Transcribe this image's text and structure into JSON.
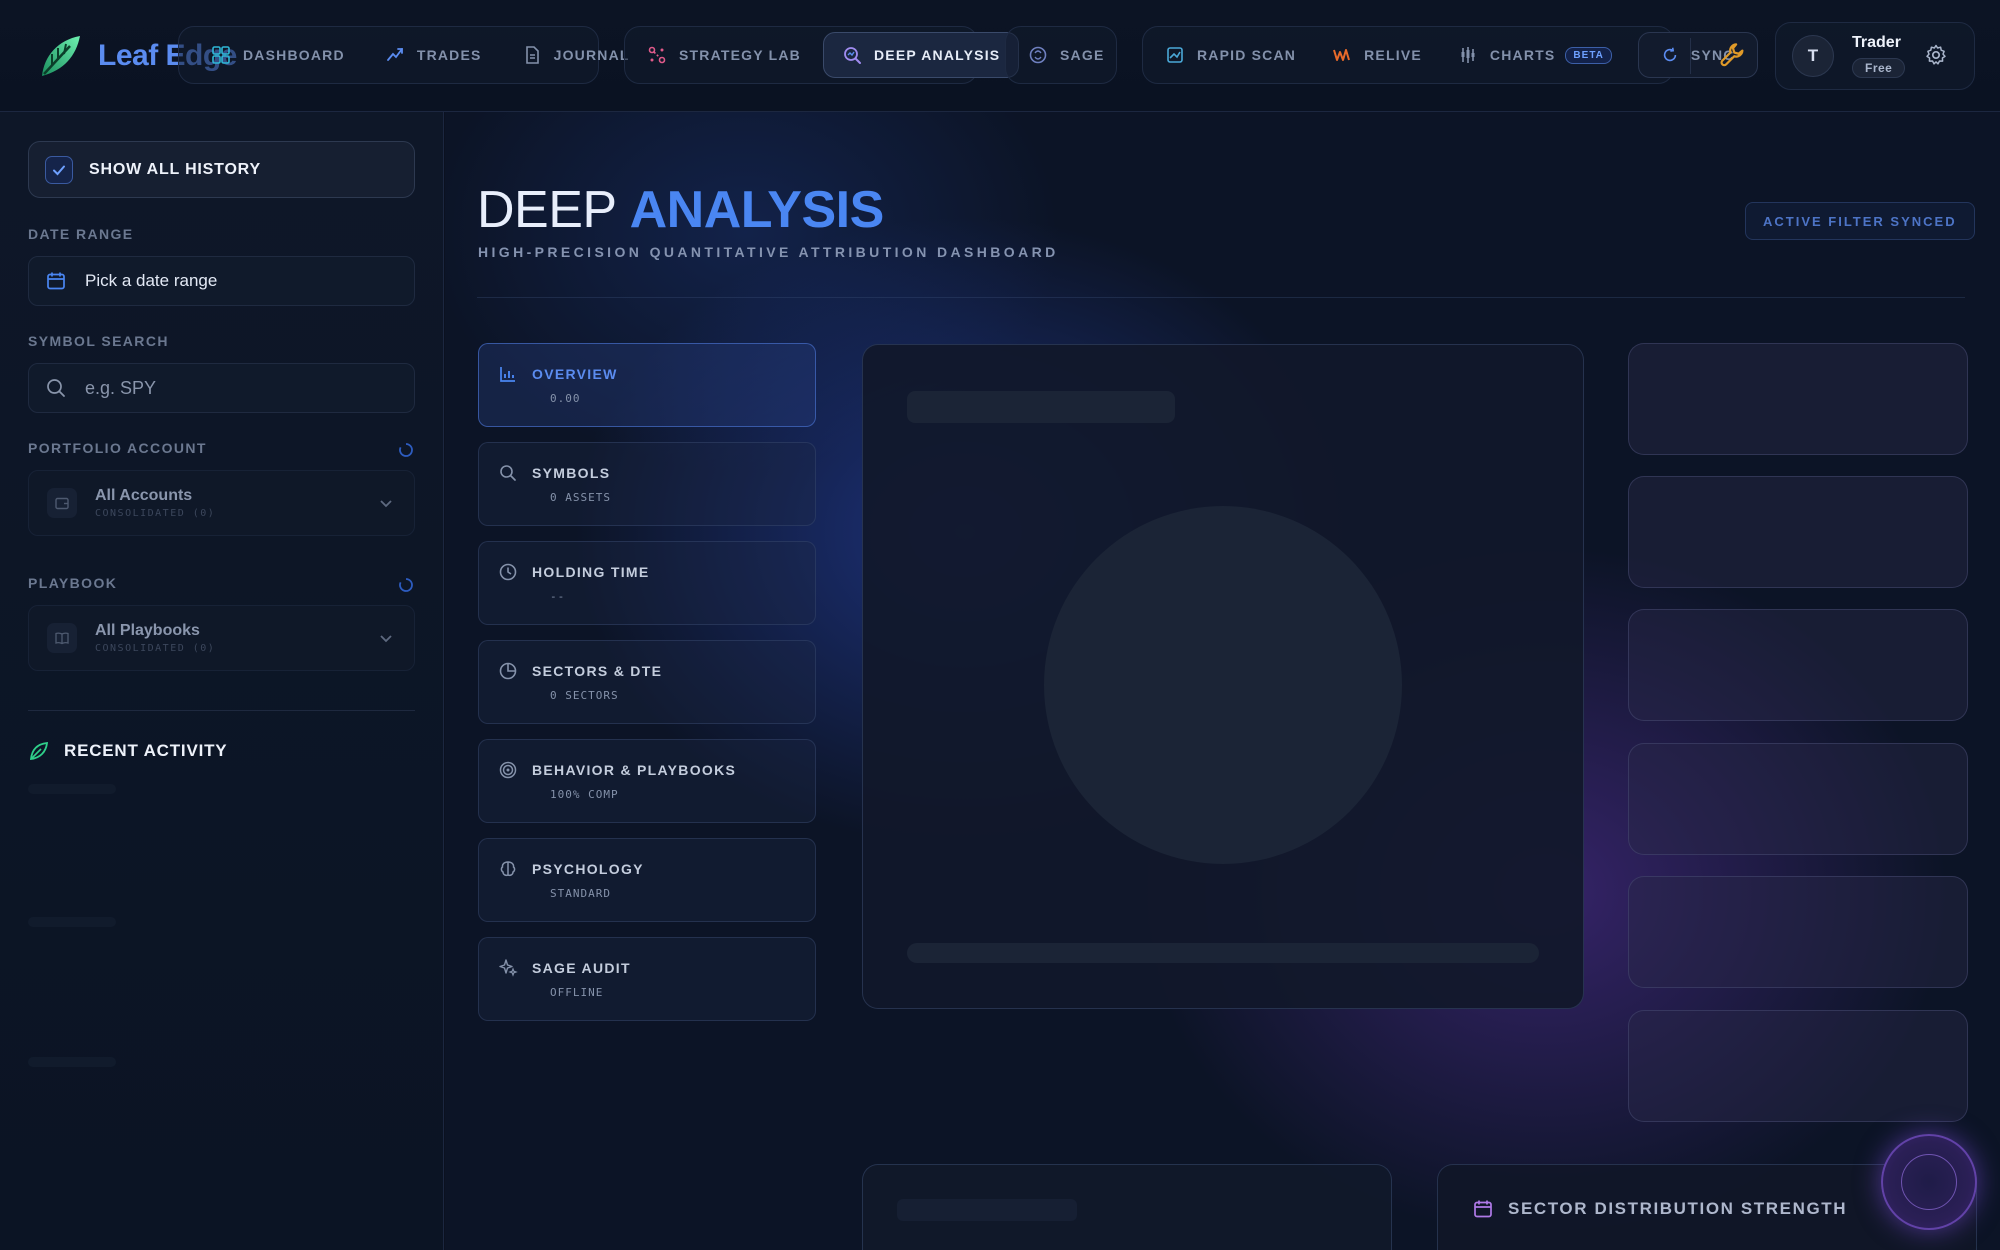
{
  "app": {
    "brand_name": "Leaf Edge"
  },
  "nav": {
    "group1": [
      {
        "label": "DASHBOARD",
        "icon": "dashboard-icon"
      },
      {
        "label": "TRADES",
        "icon": "trades-icon"
      },
      {
        "label": "JOURNAL",
        "icon": "journal-icon"
      }
    ],
    "group2": [
      {
        "label": "STRATEGY LAB",
        "icon": "strategy-lab-icon"
      },
      {
        "label": "DEEP ANALYSIS",
        "icon": "deep-analysis-icon",
        "active": true
      }
    ],
    "group3": [
      {
        "label": "SAGE",
        "icon": "sage-icon"
      }
    ],
    "group4": [
      {
        "label": "RAPID SCAN",
        "icon": "rapid-scan-icon"
      },
      {
        "label": "RELIVE",
        "icon": "relive-icon"
      },
      {
        "label": "CHARTS",
        "icon": "charts-icon",
        "badge": "BETA"
      }
    ],
    "sync_label": "SYNC"
  },
  "user": {
    "initial": "T",
    "name": "Trader",
    "plan": "Free"
  },
  "sidebar": {
    "show_history_label": "SHOW ALL HISTORY",
    "date_range_label": "DATE RANGE",
    "date_range_value": "Pick a date range",
    "symbol_search_label": "SYMBOL SEARCH",
    "symbol_search_placeholder": "e.g. SPY",
    "portfolio_label": "PORTFOLIO ACCOUNT",
    "portfolio_title": "All Accounts",
    "portfolio_sub": "CONSOLIDATED (0)",
    "playbook_label": "PLAYBOOK",
    "playbook_title": "All Playbooks",
    "playbook_sub": "CONSOLIDATED (0)",
    "recent_activity_label": "RECENT ACTIVITY"
  },
  "main": {
    "title_plain": "DEEP ",
    "title_accent": "ANALYSIS",
    "subtitle": "HIGH-PRECISION QUANTITATIVE ATTRIBUTION DASHBOARD",
    "sync_tag": "ACTIVE FILTER SYNCED",
    "tabs": [
      {
        "title": "OVERVIEW",
        "value": "0.00",
        "icon": "overview-bar-chart-icon",
        "active": true
      },
      {
        "title": "SYMBOLS",
        "value": "0 ASSETS",
        "icon": "symbols-search-icon"
      },
      {
        "title": "HOLDING TIME",
        "value": "--",
        "icon": "holding-time-clock-icon"
      },
      {
        "title": "SECTORS & DTE",
        "value": "0 SECTORS",
        "icon": "sectors-pie-icon"
      },
      {
        "title": "BEHAVIOR & PLAYBOOKS",
        "value": "100% COMP",
        "icon": "behavior-target-icon"
      },
      {
        "title": "PSYCHOLOGY",
        "value": "STANDARD",
        "icon": "psychology-brain-icon"
      },
      {
        "title": "SAGE AUDIT",
        "value": "OFFLINE",
        "icon": "sage-audit-sparkle-icon"
      }
    ],
    "sector_panel_title": "SECTOR DISTRIBUTION STRENGTH"
  },
  "colors": {
    "accent_blue": "#4a86f2",
    "brand_green": "#2fd08a",
    "purple_glow": "#8a5ae6",
    "background": "#0b1120"
  }
}
